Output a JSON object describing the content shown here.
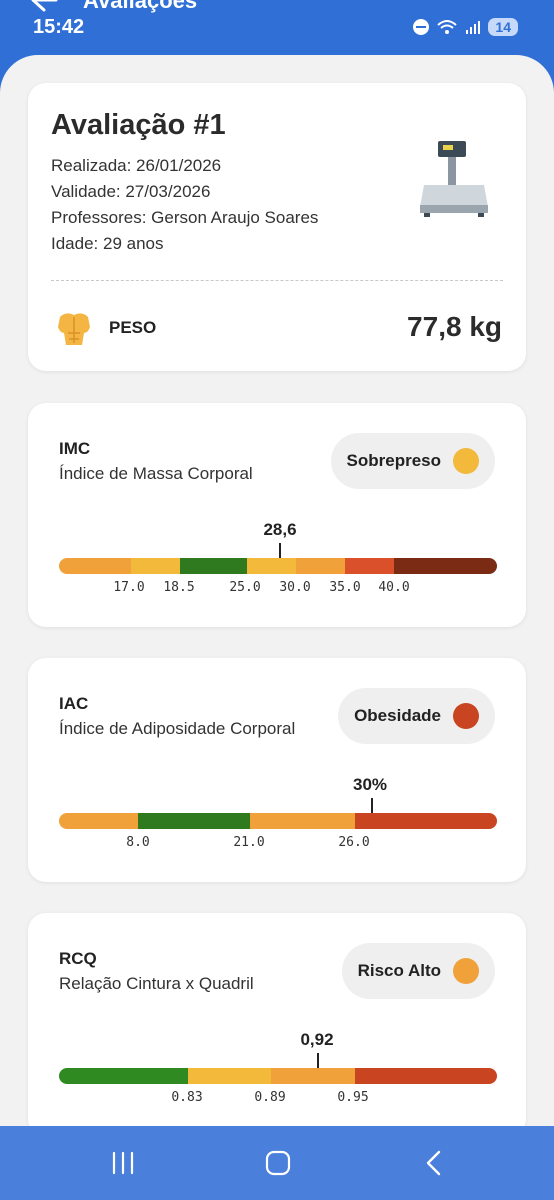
{
  "status_bar": {
    "time": "15:42",
    "battery": "14"
  },
  "header": {
    "title": "Avaliações"
  },
  "evaluation": {
    "title": "Avaliação #1",
    "realizada": "Realizada: 26/01/2026",
    "validade": "Validade: 27/03/2026",
    "professores": "Professores: Gerson Araujo Soares",
    "idade": "Idade: 29 anos",
    "weight_label": "PESO",
    "weight_value": "77,8 kg"
  },
  "metrics": [
    {
      "code": "IMC",
      "name": "Índice de Massa Corporal",
      "status": "Sobrepreso",
      "status_color": "#f2b93b",
      "value": "28,6",
      "value_numeric": 28.6,
      "segments": [
        {
          "color": "#f0a13a",
          "span": 16
        },
        {
          "color": "#f2b93b",
          "span": 11
        },
        {
          "color": "#2f7a1f",
          "span": 15
        },
        {
          "color": "#f2b93b",
          "span": 11
        },
        {
          "color": "#f0a13a",
          "span": 11
        },
        {
          "color": "#d9502a",
          "span": 11
        },
        {
          "color": "#7b2a14",
          "span": 23
        }
      ],
      "ticks": [
        "17.0",
        "18.5",
        "25.0",
        "30.0",
        "35.0",
        "40.0"
      ]
    },
    {
      "code": "IAC",
      "name": "Índice de Adiposidade Corporal",
      "status": "Obesidade",
      "status_color": "#c94421",
      "value": "30%",
      "value_numeric": 30,
      "segments": [
        {
          "color": "#f0a13a",
          "span": 18
        },
        {
          "color": "#2f7a1f",
          "span": 25.5
        },
        {
          "color": "#f0a13a",
          "span": 24
        },
        {
          "color": "#c94421",
          "span": 32.5
        }
      ],
      "ticks": [
        "8.0",
        "21.0",
        "26.0"
      ]
    },
    {
      "code": "RCQ",
      "name": "Relação Cintura x Quadril",
      "status": "Risco Alto",
      "status_color": "#f0a13a",
      "value": "0,92",
      "value_numeric": 0.92,
      "segments": [
        {
          "color": "#2f8a22",
          "span": 29.5
        },
        {
          "color": "#f2b93b",
          "span": 19
        },
        {
          "color": "#f0a13a",
          "span": 19
        },
        {
          "color": "#c94421",
          "span": 32.5
        }
      ],
      "ticks": [
        "0.83",
        "0.89",
        "0.95"
      ]
    }
  ],
  "icons": {
    "back": "back-arrow-icon",
    "scale": "scale-icon",
    "muscle": "muscle-torso-icon",
    "nav_recent": "recent-apps-icon",
    "nav_home": "home-icon",
    "nav_back": "nav-back-icon"
  }
}
